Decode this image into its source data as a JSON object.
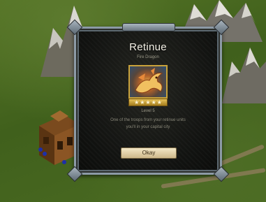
{
  "dialog": {
    "title": "Retinue",
    "subtitle": "Fire Dragon",
    "portrait_icon": "fire-dragon-portrait-icon",
    "star_rating": 5,
    "star_max": 5,
    "level_text": "Level 5",
    "description_line1": "One of the troops from your retinue units",
    "description_line2": "you'll in your capital city",
    "okay_label": "Okay"
  },
  "colors": {
    "star_banner": "#e7c25a",
    "frame": "#8c9aa6",
    "dialog_background": "#111210",
    "okay_button": "#f3e7c6"
  }
}
